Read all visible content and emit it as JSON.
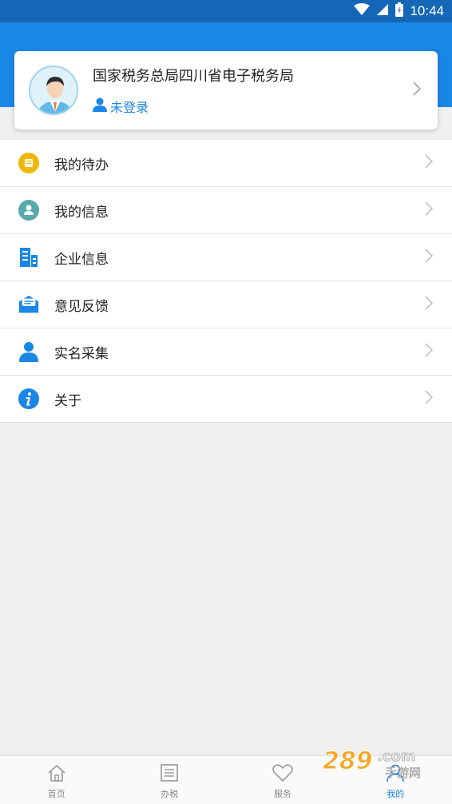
{
  "status_bar": {
    "time": "10:44",
    "icons": [
      "wifi-icon",
      "signal-icon",
      "battery-icon"
    ]
  },
  "profile": {
    "title": "国家税务总局四川省电子税务局",
    "login_status": "未登录",
    "avatar": "user-avatar",
    "chevron": "chevron-right-icon"
  },
  "menu": {
    "items": [
      {
        "label": "我的待办",
        "icon": "todo-icon",
        "color": "#f2b705"
      },
      {
        "label": "我的信息",
        "icon": "person-info-icon",
        "color": "#58a9a9"
      },
      {
        "label": "企业信息",
        "icon": "enterprise-icon",
        "color": "#1a86e6"
      },
      {
        "label": "意见反馈",
        "icon": "feedback-mail-icon",
        "color": "#1a86e6"
      },
      {
        "label": "实名采集",
        "icon": "real-name-icon",
        "color": "#1a86e6"
      },
      {
        "label": "关于",
        "icon": "info-icon",
        "color": "#1a86e6"
      }
    ]
  },
  "bottom_nav": {
    "items": [
      {
        "label": "首页",
        "icon": "home-icon",
        "active": false
      },
      {
        "label": "办税",
        "icon": "list-icon",
        "active": false
      },
      {
        "label": "服务",
        "icon": "heart-icon",
        "active": false
      },
      {
        "label": "我的",
        "icon": "user-icon",
        "active": true
      }
    ]
  },
  "colors": {
    "primary": "#1a86e6",
    "status_bar": "#1467b6",
    "background": "#efefef"
  },
  "watermark": {
    "text": "289.com",
    "sub": "手游网"
  }
}
